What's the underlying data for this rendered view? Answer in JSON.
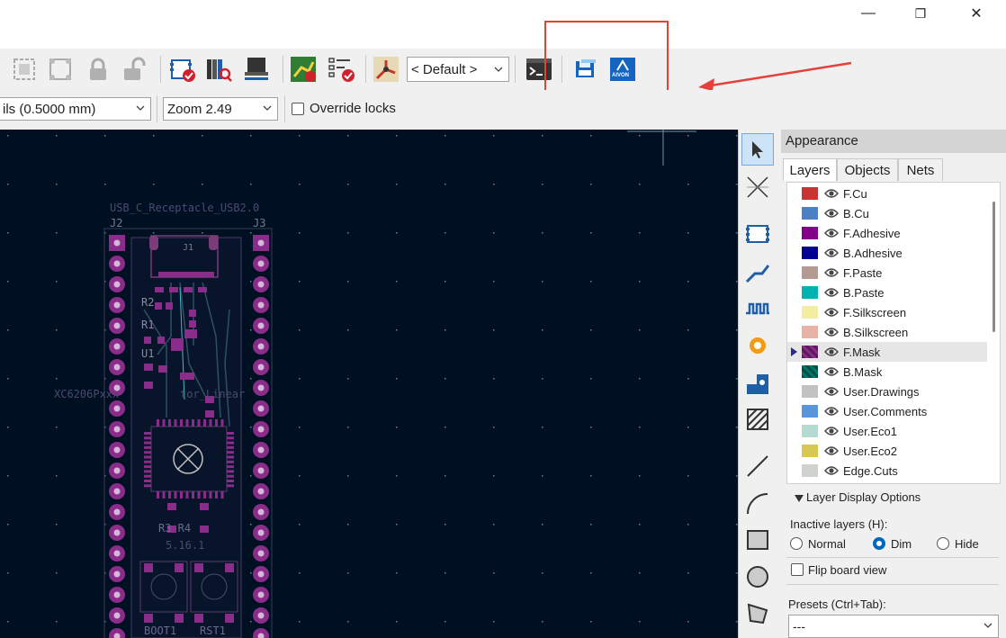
{
  "window": {
    "minimize_glyph": "—",
    "maximize_glyph": "❐",
    "close_glyph": "✕"
  },
  "toolbar": {
    "net_class_select": "< Default >",
    "grid_select": "ils (0.5000 mm)",
    "zoom_select": "Zoom 2.49",
    "override_locks_label": "Override locks",
    "plugin_icon_label": "AIVON",
    "highlight_color": "#e5413b"
  },
  "canvas": {
    "bg_color": "#001023",
    "silk_labels": {
      "footprint": "USB_C_Receptacle_USB2.0",
      "j2": "J2",
      "j3": "J3",
      "j1": "J1",
      "reg": "XC6206Pxxx",
      "reg_suffix": "tor_Linear",
      "r2": "R2",
      "r1": "R1",
      "u1": "U1",
      "ref_5161": "5.16.1",
      "r3": "R3 R4",
      "boot": "BOOT1",
      "rst": "RST1"
    }
  },
  "appearance": {
    "title": "Appearance",
    "tabs": [
      "Layers",
      "Objects",
      "Nets"
    ],
    "layers": [
      {
        "name": "F.Cu",
        "color": "#c83434"
      },
      {
        "name": "B.Cu",
        "color": "#4d7fc4"
      },
      {
        "name": "F.Adhesive",
        "color": "#84008a"
      },
      {
        "name": "B.Adhesive",
        "color": "#000094"
      },
      {
        "name": "F.Paste",
        "color": "#b39a93"
      },
      {
        "name": "B.Paste",
        "color": "#00b3b3"
      },
      {
        "name": "F.Silkscreen",
        "color": "#f2eda1"
      },
      {
        "name": "B.Silkscreen",
        "color": "#e8b2a7"
      },
      {
        "name": "F.Mask",
        "color": "#8a2c8a"
      },
      {
        "name": "B.Mask",
        "color": "#01796a"
      },
      {
        "name": "User.Drawings",
        "color": "#c2c2c2"
      },
      {
        "name": "User.Comments",
        "color": "#5995db"
      },
      {
        "name": "User.Eco1",
        "color": "#b4dbd2"
      },
      {
        "name": "User.Eco2",
        "color": "#d8c852"
      },
      {
        "name": "Edge.Cuts",
        "color": "#d0d2cd"
      }
    ],
    "selected_layer": "F.Mask",
    "display_options_label": "Layer Display Options",
    "inactive_label": "Inactive layers (H):",
    "inactive_options": [
      "Normal",
      "Dim",
      "Hide"
    ],
    "inactive_selected": "Dim",
    "flip_label": "Flip board view",
    "presets_label": "Presets (Ctrl+Tab):",
    "presets_value": "---"
  }
}
